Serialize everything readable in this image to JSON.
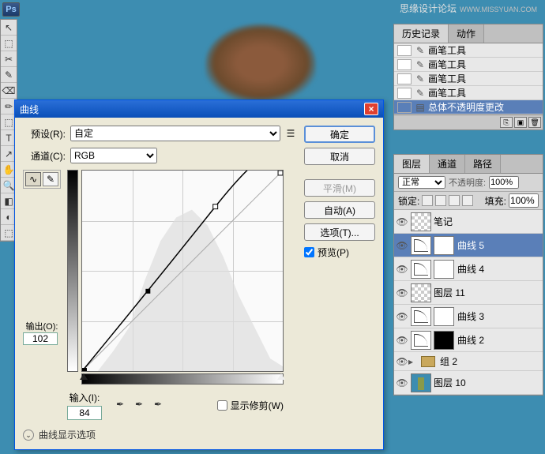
{
  "watermark": {
    "main": "思缘设计论坛",
    "sub": "WWW.MISSYUAN.COM"
  },
  "toolbox": [
    "↖",
    "⬚",
    "✂",
    "✎",
    "⌫",
    "✏",
    "⬚",
    "T",
    "↗",
    "✋",
    "🔍",
    "◧",
    "◐",
    "⬚"
  ],
  "history": {
    "tabs": [
      "历史记录",
      "动作"
    ],
    "items": [
      {
        "icon": "✎",
        "label": "画笔工具"
      },
      {
        "icon": "✎",
        "label": "画笔工具"
      },
      {
        "icon": "✎",
        "label": "画笔工具"
      },
      {
        "icon": "✎",
        "label": "画笔工具"
      },
      {
        "icon": "▤",
        "label": "总体不透明度更改",
        "selected": true
      }
    ]
  },
  "layers": {
    "tabs": [
      "图层",
      "通道",
      "路径"
    ],
    "blend_label": "正常",
    "opacity_label": "不透明度:",
    "opacity_value": "100%",
    "lock_label": "锁定:",
    "fill_label": "填充:",
    "fill_value": "100%",
    "items": [
      {
        "type": "layer",
        "thumb": "checker",
        "name": "笔记"
      },
      {
        "type": "adjust",
        "thumb": "curve",
        "mask": "white",
        "name": "曲线 5",
        "selected": true
      },
      {
        "type": "adjust",
        "thumb": "curve",
        "mask": "white",
        "name": "曲线 4"
      },
      {
        "type": "layer",
        "thumb": "checker",
        "name": "图层 11"
      },
      {
        "type": "adjust",
        "thumb": "curve",
        "mask": "white",
        "name": "曲线 3"
      },
      {
        "type": "adjust",
        "thumb": "curve",
        "mask": "black",
        "name": "曲线 2"
      },
      {
        "type": "group",
        "name": "组 2"
      },
      {
        "type": "layer",
        "thumb": "img",
        "name": "图层 10"
      }
    ]
  },
  "curves": {
    "title": "曲线",
    "preset_label": "预设(R):",
    "preset_value": "自定",
    "channel_label": "通道(C):",
    "channel_value": "RGB",
    "output_label": "输出(O):",
    "output_value": "102",
    "input_label": "输入(I):",
    "input_value": "84",
    "show_clip": "显示修剪(W)",
    "disclosure": "曲线显示选项",
    "buttons": {
      "ok": "确定",
      "cancel": "取消",
      "smooth": "平滑(M)",
      "auto": "自动(A)",
      "options": "选项(T)...",
      "preview": "预览(P)"
    }
  },
  "chart_data": {
    "type": "line",
    "title": "Curves adjustment (RGB)",
    "xlabel": "Input",
    "ylabel": "Output",
    "xlim": [
      0,
      255
    ],
    "ylim": [
      0,
      255
    ],
    "series": [
      {
        "name": "identity",
        "x": [
          0,
          255
        ],
        "y": [
          0,
          255
        ]
      },
      {
        "name": "curve",
        "x": [
          0,
          84,
          170,
          255
        ],
        "y": [
          0,
          102,
          210,
          255
        ]
      }
    ],
    "histogram_note": "background histogram shown (not quantified)"
  }
}
